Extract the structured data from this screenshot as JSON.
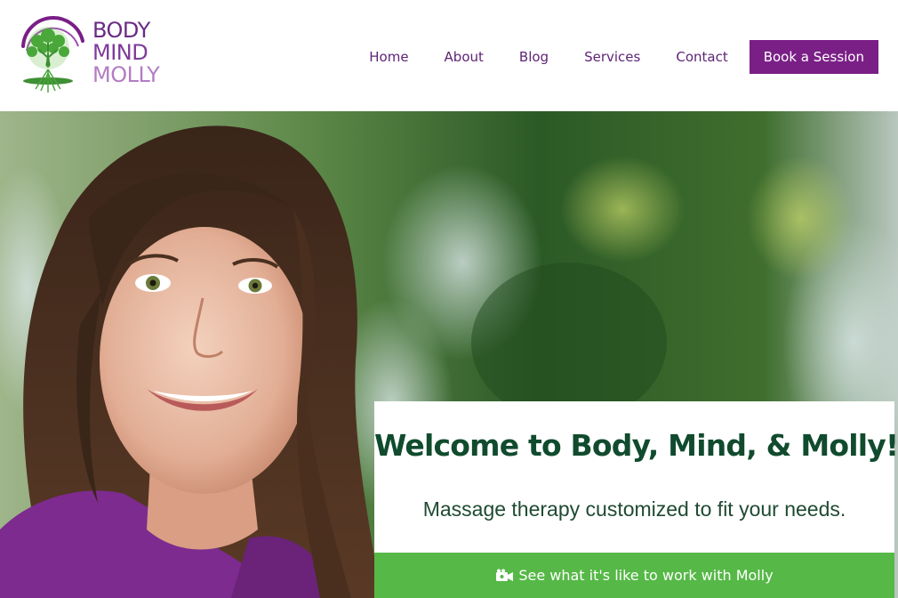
{
  "brand": {
    "line1": "BODY",
    "line2": "MIND",
    "line3": "MOLLY",
    "mark_icon": "tree-of-life-icon"
  },
  "nav": {
    "items": [
      {
        "label": "Home"
      },
      {
        "label": "About"
      },
      {
        "label": "Blog"
      },
      {
        "label": "Services"
      },
      {
        "label": "Contact"
      }
    ],
    "cta_label": "Book a Session"
  },
  "hero": {
    "photo": "portrait-photo"
  },
  "welcome": {
    "title": "Welcome to Body, Mind, & Molly!",
    "subtitle": "Massage therapy customized to fit your needs.",
    "video_button_label": "See what it's like to work with Molly",
    "video_icon": "video-camera-icon"
  },
  "colors": {
    "brand_purple": "#7a1f86",
    "brand_green": "#56b847",
    "title_green": "#114b2e"
  }
}
